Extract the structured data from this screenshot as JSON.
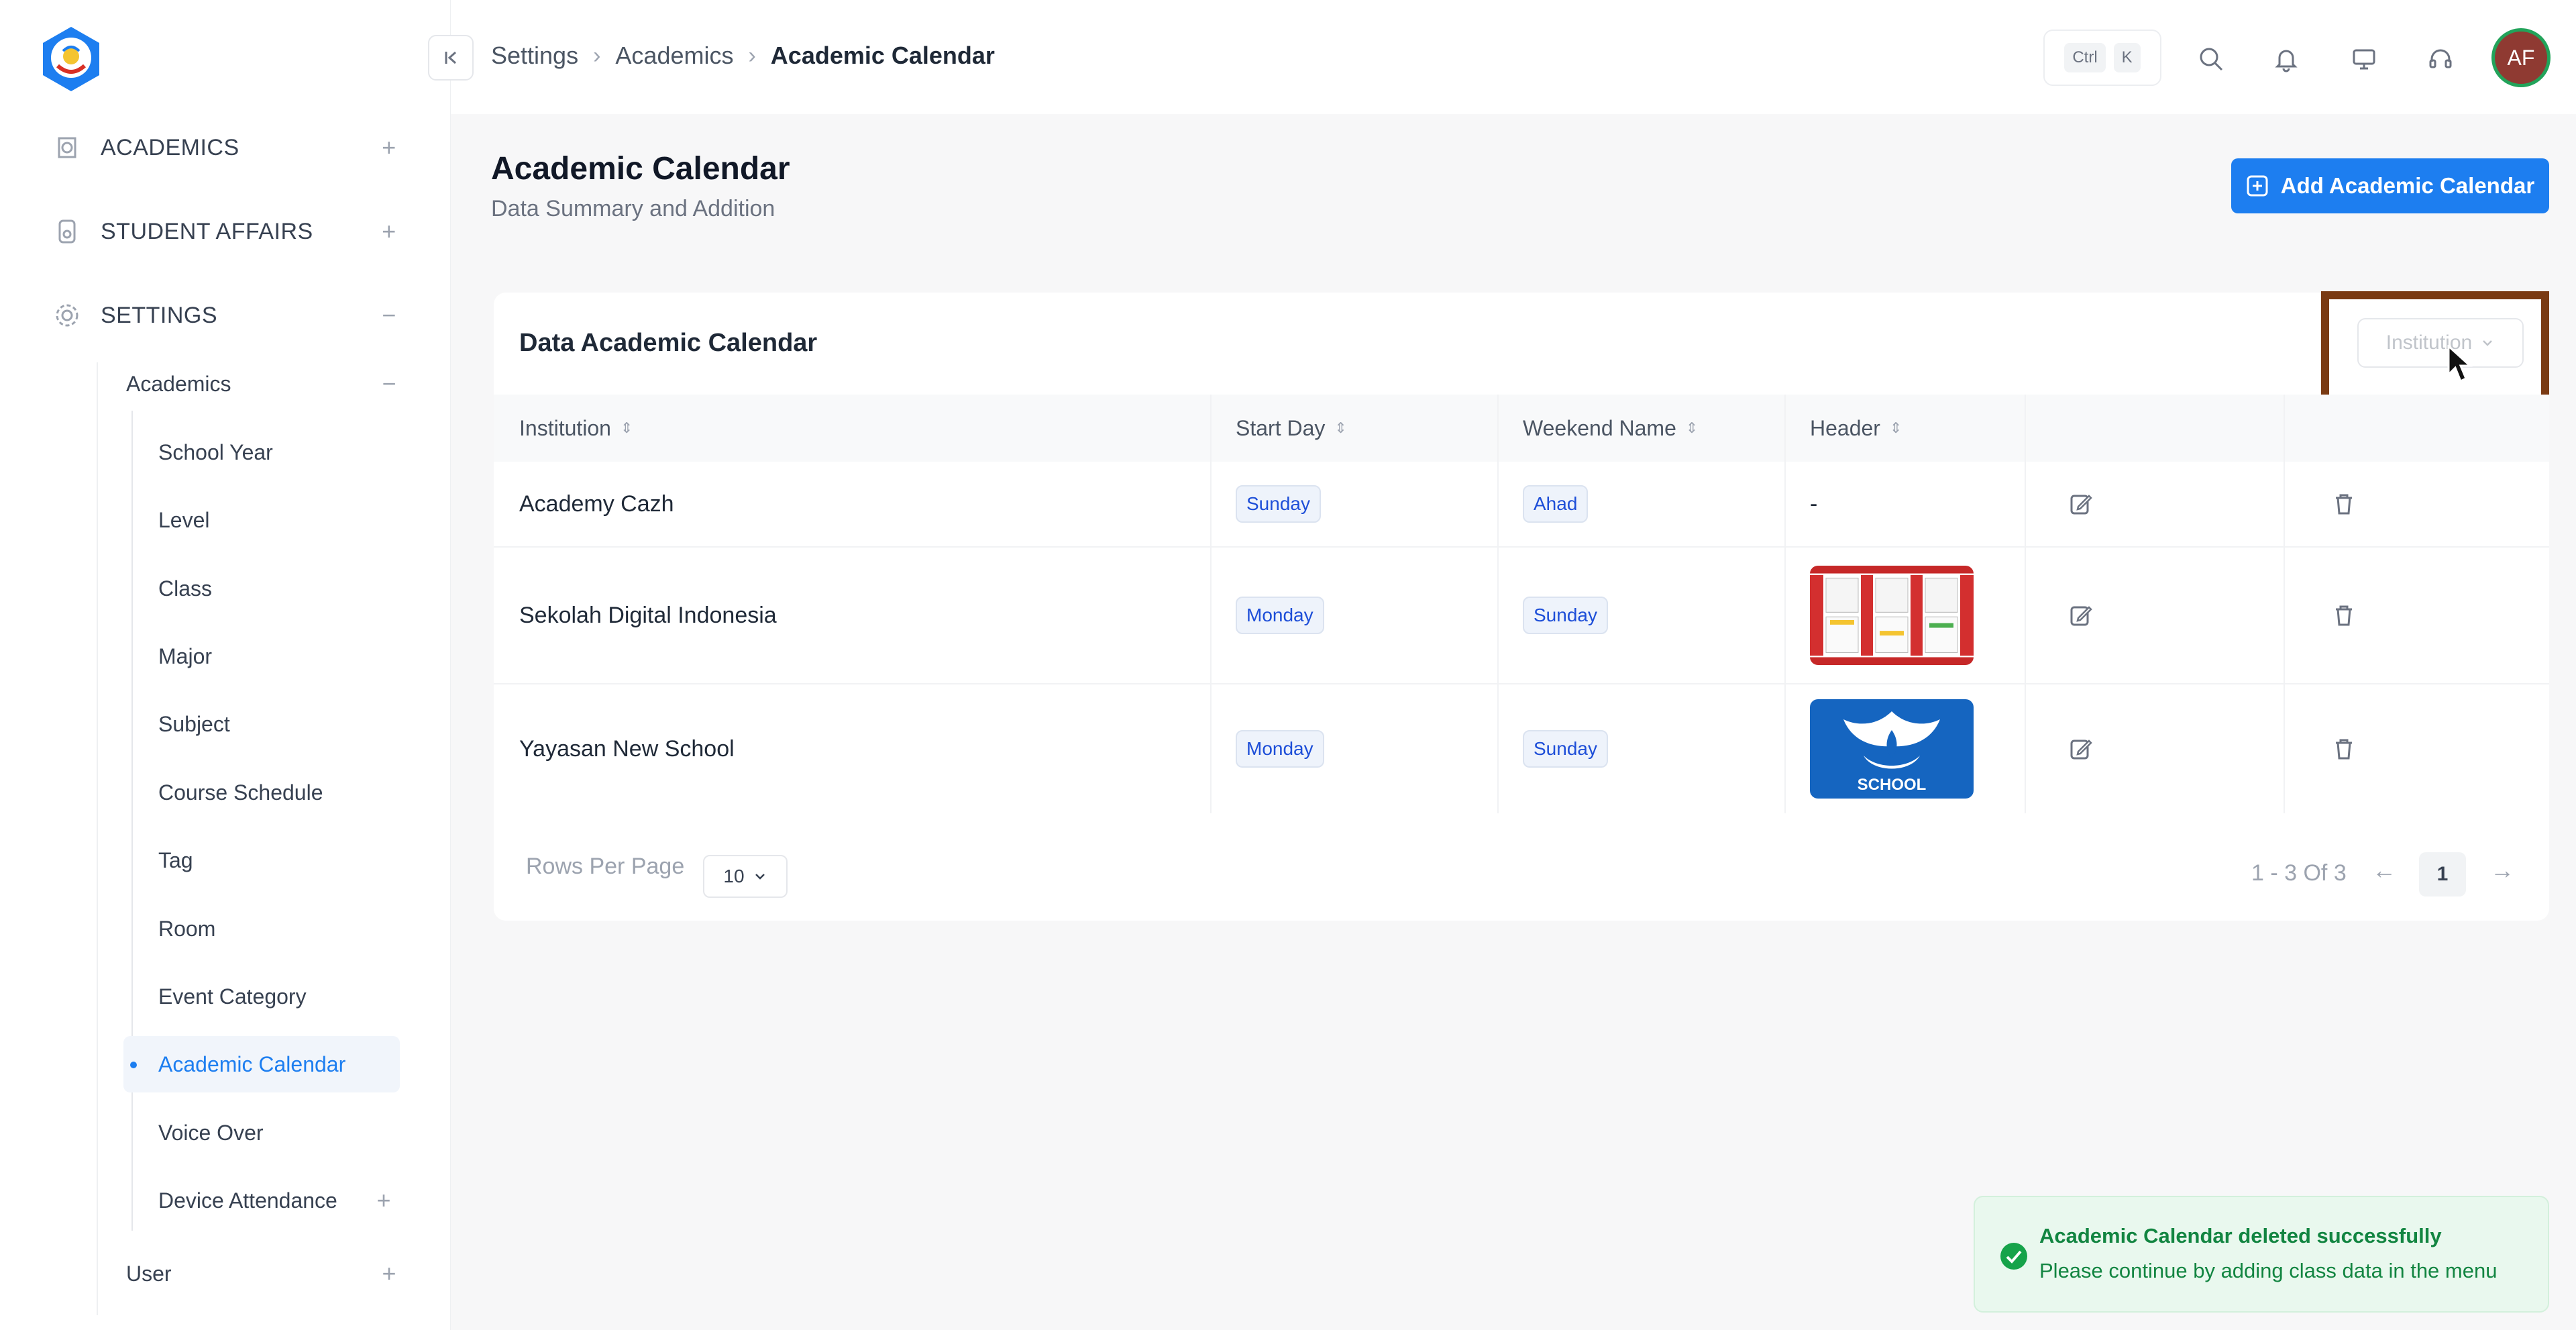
{
  "colors": {
    "accent": "#1d7ef0",
    "highlight_border": "#7a3a12",
    "success_bg": "#e9f8ee",
    "success_text": "#128541",
    "avatar_bg": "#8f3a32",
    "avatar_ring": "#22a35a"
  },
  "sidebar": {
    "groups": [
      {
        "label": "ACADEMICS",
        "icon": "academics-icon",
        "toggle": "+"
      },
      {
        "label": "STUDENT AFFAIRS",
        "icon": "student-affairs-icon",
        "toggle": "+"
      },
      {
        "label": "SETTINGS",
        "icon": "gear-icon",
        "toggle": "−"
      }
    ],
    "settings_sub": {
      "academics_label": "Academics",
      "academics_toggle": "−",
      "items": [
        {
          "label": "School Year"
        },
        {
          "label": "Level"
        },
        {
          "label": "Class"
        },
        {
          "label": "Major"
        },
        {
          "label": "Subject"
        },
        {
          "label": "Course Schedule"
        },
        {
          "label": "Tag"
        },
        {
          "label": "Room"
        },
        {
          "label": "Event Category"
        },
        {
          "label": "Academic Calendar",
          "active": true
        },
        {
          "label": "Voice Over"
        },
        {
          "label": "Device Attendance",
          "toggle": "+"
        }
      ],
      "user_label": "User",
      "user_toggle": "+"
    }
  },
  "header": {
    "breadcrumb": [
      "Settings",
      "Academics",
      "Academic Calendar"
    ],
    "shortcut_keys": [
      "Ctrl",
      "K"
    ],
    "icons": [
      "search-icon",
      "bell-icon",
      "monitor-icon",
      "headset-icon"
    ],
    "avatar_initials": "AF"
  },
  "page": {
    "title": "Academic Calendar",
    "subtitle": "Data Summary and Addition",
    "add_button_label": "Add Academic Calendar"
  },
  "card": {
    "title": "Data Academic Calendar",
    "filter_placeholder": "Institution",
    "columns": [
      "Institution",
      "Start Day",
      "Weekend Name",
      "Header"
    ],
    "rows": [
      {
        "institution": "Academy Cazh",
        "start_day": "Sunday",
        "weekend_name": "Ahad",
        "header": "-"
      },
      {
        "institution": "Sekolah Digital Indonesia",
        "start_day": "Monday",
        "weekend_name": "Sunday",
        "header": "calendar-image"
      },
      {
        "institution": "Yayasan New School",
        "start_day": "Monday",
        "weekend_name": "Sunday",
        "header": "school-logo-image"
      }
    ],
    "header_image_text": "SCHOOL",
    "rows_per_page_label": "Rows Per Page",
    "rows_per_page_value": "10",
    "pagination_info": "1 - 3 Of 3",
    "current_page": "1",
    "prev_arrow": "←",
    "next_arrow": "→"
  },
  "toast": {
    "title": "Academic Calendar deleted successfully",
    "message": "Please continue by adding class data in the menu"
  }
}
